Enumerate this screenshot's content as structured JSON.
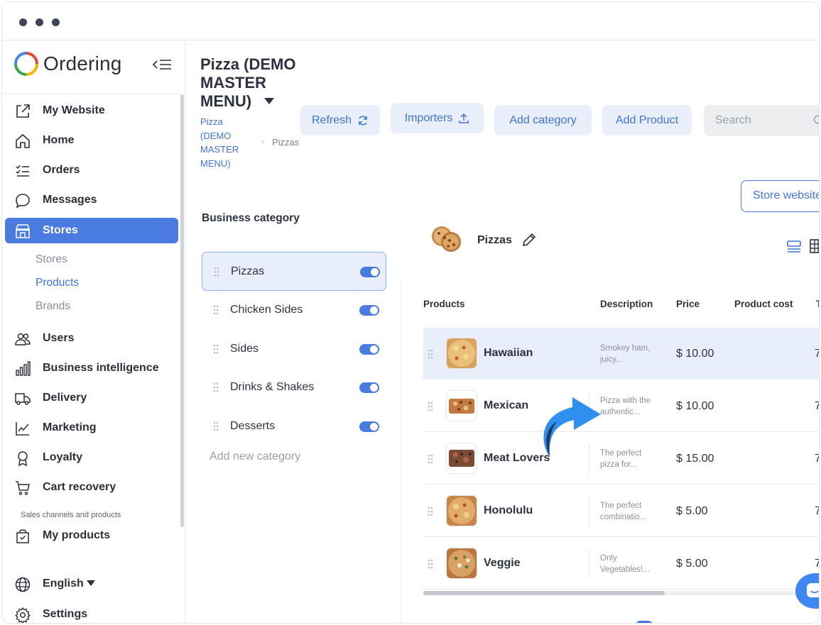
{
  "sidebar": {
    "brand": "Ordering",
    "items": [
      {
        "label": "My Website",
        "icon": "external-link-icon"
      },
      {
        "label": "Home",
        "icon": "home-icon"
      },
      {
        "label": "Orders",
        "icon": "list-check-icon"
      },
      {
        "label": "Messages",
        "icon": "chat-bubble-icon"
      },
      {
        "label": "Stores",
        "icon": "storefront-icon",
        "active": true
      },
      {
        "label": "Users",
        "icon": "users-icon"
      },
      {
        "label": "Business intelligence",
        "icon": "bar-chart-icon"
      },
      {
        "label": "Delivery",
        "icon": "truck-icon"
      },
      {
        "label": "Marketing",
        "icon": "line-chart-icon"
      },
      {
        "label": "Loyalty",
        "icon": "award-icon"
      },
      {
        "label": "Cart recovery",
        "icon": "cart-icon"
      },
      {
        "label": "My products",
        "icon": "shopping-bag-icon"
      },
      {
        "label": "English",
        "icon": "globe-icon"
      },
      {
        "label": "Settings",
        "icon": "gear-icon"
      }
    ],
    "stores_sub": [
      "Stores",
      "Products",
      "Brands"
    ],
    "section_label": "Sales channels and products"
  },
  "header": {
    "title": "Pizza (DEMO MASTER MENU)",
    "breadcrumb_link": "Pizza (DEMO MASTER MENU)",
    "breadcrumb_current": "Pizzas",
    "buttons": {
      "refresh": "Refresh",
      "importers": "Importers",
      "add_category": "Add category",
      "add_product": "Add Product"
    },
    "search_placeholder": "Search",
    "store_website": "Store website"
  },
  "categories": {
    "heading": "Business category",
    "items": [
      {
        "name": "Pizzas",
        "enabled": true,
        "selected": true
      },
      {
        "name": "Chicken Sides",
        "enabled": true
      },
      {
        "name": "Sides",
        "enabled": true
      },
      {
        "name": "Drinks & Shakes",
        "enabled": true
      },
      {
        "name": "Desserts",
        "enabled": true
      }
    ],
    "add_new": "Add new category"
  },
  "category_header": {
    "name": "Pizzas"
  },
  "table": {
    "columns": [
      "Products",
      "Description",
      "Price",
      "Product cost",
      "T"
    ],
    "rows": [
      {
        "name": "Hawaiian",
        "description": "Smokey ham, juicy...",
        "price": "$ 10.00",
        "extra": "7"
      },
      {
        "name": "Mexican",
        "description": "Pizza with the authentic...",
        "price": "$ 10.00",
        "extra": "7"
      },
      {
        "name": "Meat Lovers",
        "description": "The perfect pizza for...",
        "price": "$ 15.00",
        "extra": "7"
      },
      {
        "name": "Honolulu",
        "description": "The perfect combinatio...",
        "price": "$ 5.00",
        "extra": "7"
      },
      {
        "name": "Veggie",
        "description": "Only Vegetables!...",
        "price": "$ 5.00",
        "extra": "7"
      }
    ]
  },
  "colors": {
    "accent": "#4a7be0",
    "link": "#3f74d9",
    "arrow": "#2f8ff0"
  }
}
